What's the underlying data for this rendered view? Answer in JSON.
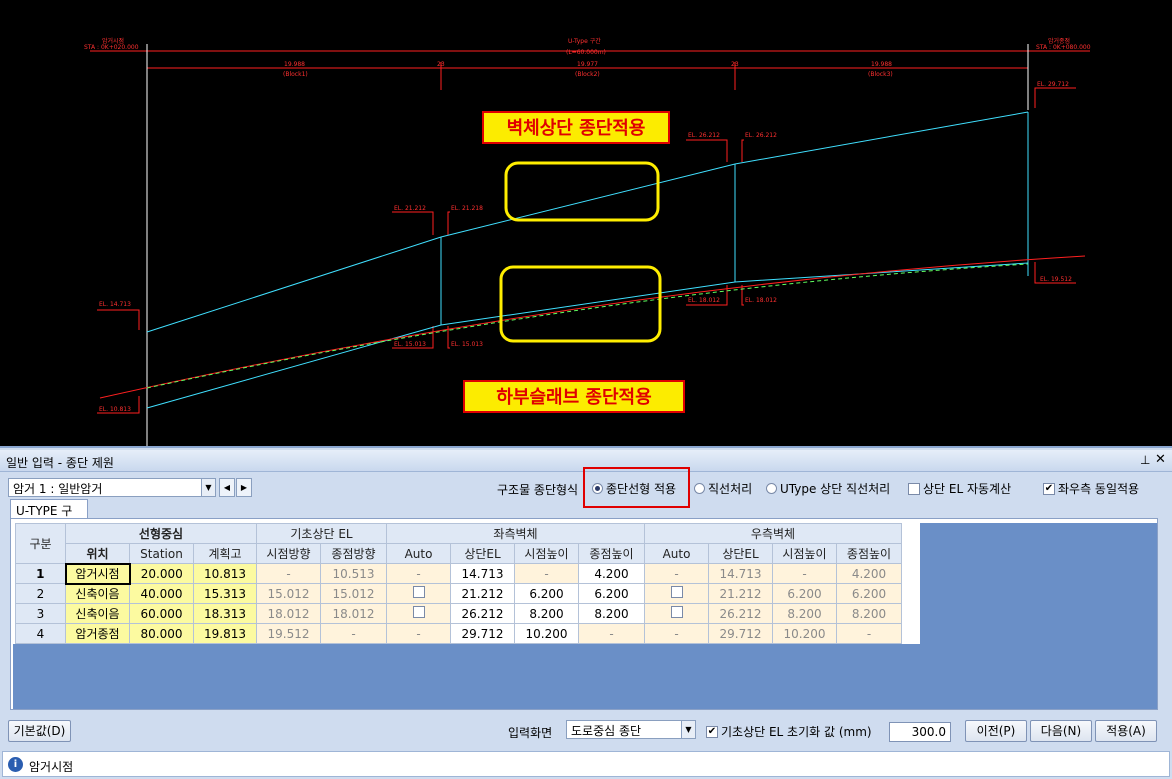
{
  "cad": {
    "top_left_label": "암거시점",
    "top_left_sta": "STA : 0K+020.000",
    "top_center_label": "U-Type 구간",
    "top_center_len": "(L=60.000m)",
    "top_right_label": "암거종점",
    "top_right_sta": "STA : 0K+080.000",
    "block1_len": "19.988",
    "block1_name": "(Block1)",
    "joint1": "23",
    "block2_len": "19.977",
    "block2_name": "(Block2)",
    "joint2": "23",
    "block3_len": "19.988",
    "block3_name": "(Block3)",
    "el_labels": [
      "EL. 14.713",
      "EL. 10.813",
      "EL. 21.212",
      "EL. 21.218",
      "EL. 15.013",
      "EL. 15.013",
      "EL. 26.212",
      "EL. 26.212",
      "EL. 18.012",
      "EL. 18.012",
      "EL. 29.712",
      "EL. 19.512"
    ],
    "annotation_top": "벽체상단 종단적용",
    "annotation_bottom": "하부슬래브 종단적용"
  },
  "panel": {
    "title": "일반 입력 - 종단 제원",
    "pin_icon": "pin-icon",
    "close_icon": "close-icon",
    "culvert_select": "암거 1 : 일반암거",
    "structure_label": "구조물 종단형식",
    "radio_options": [
      "종단선형 적용",
      "직선처리",
      "UType 상단 직선처리"
    ],
    "selected_radio": 0,
    "check_auto_el": "상단 EL 자동계산",
    "check_auto_el_checked": false,
    "check_same": "좌우측 동일적용",
    "check_same_checked": true,
    "tab": "U-TYPE 구간"
  },
  "grid": {
    "group_headers": [
      "구분",
      "선형중심",
      "기초상단 EL",
      "좌측벽체",
      "우측벽체"
    ],
    "sub_headers": [
      "위치",
      "Station",
      "계획고",
      "시점방향",
      "종점방향",
      "Auto",
      "상단EL",
      "시점높이",
      "종점높이",
      "Auto",
      "상단EL",
      "시점높이",
      "종점높이"
    ],
    "rows": [
      [
        "1",
        "암거시점",
        "20.000",
        "10.813",
        "-",
        "10.513",
        "-",
        "14.713",
        "-",
        "4.200",
        "-",
        "14.713",
        "-",
        "4.200"
      ],
      [
        "2",
        "신축이음",
        "40.000",
        "15.313",
        "15.012",
        "15.012",
        "",
        "21.212",
        "6.200",
        "6.200",
        "",
        "21.212",
        "6.200",
        "6.200"
      ],
      [
        "3",
        "신축이음",
        "60.000",
        "18.313",
        "18.012",
        "18.012",
        "",
        "26.212",
        "8.200",
        "8.200",
        "",
        "26.212",
        "8.200",
        "8.200"
      ],
      [
        "4",
        "암거종점",
        "80.000",
        "19.813",
        "19.512",
        "-",
        "-",
        "29.712",
        "10.200",
        "-",
        "-",
        "29.712",
        "10.200",
        "-"
      ]
    ]
  },
  "footer": {
    "default_btn": "기본값(D)",
    "input_screen_label": "입력화면",
    "input_screen_value": "도로중심 종단",
    "init_check_label": "기초상단 EL 초기화 값 (mm)",
    "init_check_checked": true,
    "init_value": "300.0",
    "prev_btn": "이전(P)",
    "next_btn": "다음(N)",
    "apply_btn": "적용(A)",
    "status_icon": "info-icon",
    "status_text": "암거시점"
  }
}
